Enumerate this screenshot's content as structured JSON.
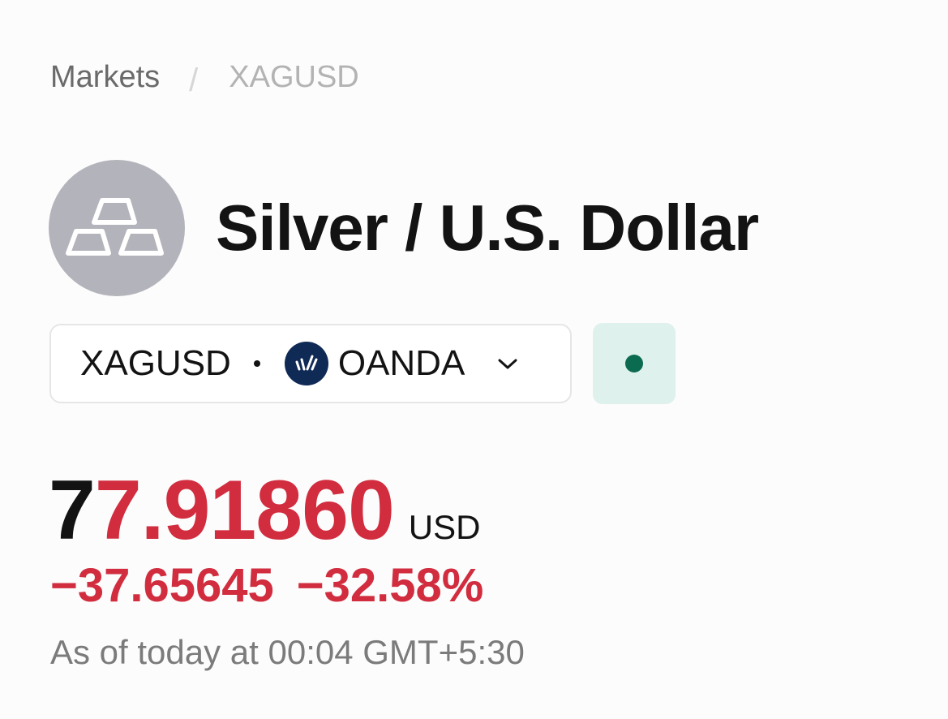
{
  "breadcrumb": {
    "parent": "Markets",
    "separator": "/",
    "current": "XAGUSD"
  },
  "instrument": {
    "icon": "silver-bars-icon",
    "title": "Silver / U.S. Dollar"
  },
  "symbol_selector": {
    "symbol": "XAGUSD",
    "exchange_icon": "oanda-logo-icon",
    "exchange": "OANDA",
    "dropdown_icon": "chevron-down-icon"
  },
  "market_status": {
    "icon": "market-open-dot-icon",
    "color": "#0b6b50"
  },
  "quote": {
    "price_unchanged_part": "7",
    "price_changed_part": "7.91860",
    "currency": "USD",
    "change": "−37.65645",
    "change_percent": "−32.58%",
    "timestamp": "As of today at 00:04 GMT+5:30"
  },
  "colors": {
    "negative": "#d12d3f",
    "status_bg": "#dff1ec",
    "avatar_bg": "#b3b3bb",
    "exchange_logo_bg": "#102a56"
  }
}
